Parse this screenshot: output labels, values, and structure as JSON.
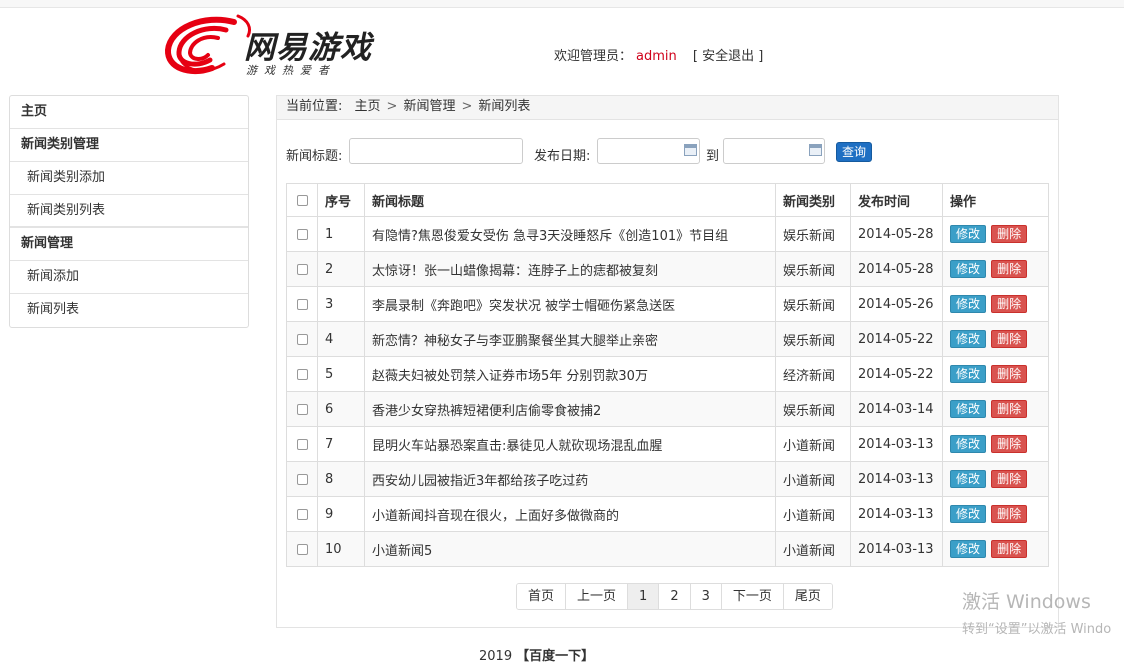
{
  "header": {
    "logo_text": "网易游戏",
    "logo_sub": "游戏热爱者",
    "welcome_label": "欢迎管理员：",
    "username": "admin",
    "logout_label": "[ 安全退出 ]"
  },
  "sidebar": {
    "items": [
      {
        "label": "主页"
      },
      {
        "label": "新闻类别管理"
      },
      {
        "label": "新闻类别添加"
      },
      {
        "label": "新闻类别列表"
      },
      {
        "label": "新闻管理"
      },
      {
        "label": "新闻添加"
      },
      {
        "label": "新闻列表"
      }
    ]
  },
  "breadcrumb": {
    "prefix": "当前位置:",
    "items": [
      "主页",
      "新闻管理",
      "新闻列表"
    ],
    "separator": ">"
  },
  "search": {
    "title_label": "新闻标题:",
    "title_value": "",
    "date_label": "发布日期:",
    "date_from": "",
    "to_label": "到",
    "date_to": "",
    "query_label": "查询"
  },
  "table": {
    "headers": {
      "no": "序号",
      "title": "新闻标题",
      "category": "新闻类别",
      "date": "发布时间",
      "actions": "操作"
    },
    "edit_label": "修改",
    "delete_label": "删除",
    "rows": [
      {
        "no": "1",
        "title": "有隐情?焦恩俊爱女受伤 急寻3天没睡怒斥《创造101》节目组",
        "category": "娱乐新闻",
        "date": "2014-05-28"
      },
      {
        "no": "2",
        "title": "太惊讶！张一山蜡像揭幕：连脖子上的痣都被复刻",
        "category": "娱乐新闻",
        "date": "2014-05-28"
      },
      {
        "no": "3",
        "title": "李晨录制《奔跑吧》突发状况 被学士帽砸伤紧急送医",
        "category": "娱乐新闻",
        "date": "2014-05-26"
      },
      {
        "no": "4",
        "title": "新恋情？神秘女子与李亚鹏聚餐坐其大腿举止亲密",
        "category": "娱乐新闻",
        "date": "2014-05-22"
      },
      {
        "no": "5",
        "title": "赵薇夫妇被处罚禁入证券市场5年 分别罚款30万",
        "category": "经济新闻",
        "date": "2014-05-22"
      },
      {
        "no": "6",
        "title": "香港少女穿热裤短裙便利店偷零食被捕2",
        "category": "娱乐新闻",
        "date": "2014-03-14"
      },
      {
        "no": "7",
        "title": "昆明火车站暴恐案直击:暴徒见人就砍现场混乱血腥",
        "category": "小道新闻",
        "date": "2014-03-13"
      },
      {
        "no": "8",
        "title": "西安幼儿园被指近3年都给孩子吃过药",
        "category": "小道新闻",
        "date": "2014-03-13"
      },
      {
        "no": "9",
        "title": "小道新闻抖音现在很火，上面好多做微商的",
        "category": "小道新闻",
        "date": "2014-03-13"
      },
      {
        "no": "10",
        "title": "小道新闻5",
        "category": "小道新闻",
        "date": "2014-03-13"
      }
    ]
  },
  "pager": {
    "first": "首页",
    "prev": "上一页",
    "pages": [
      "1",
      "2",
      "3"
    ],
    "current": "1",
    "next": "下一页",
    "last": "尾页"
  },
  "footer": {
    "year": "2019",
    "link": "【百度一下】"
  },
  "watermark": {
    "line1": "激活 Windows",
    "line2": "转到“设置”以激活 Windo"
  },
  "colors": {
    "logo_red": "#e60012",
    "admin_red": "#d0021b",
    "query_blue": "#1e6fc3",
    "edit_blue": "#3b9fc8",
    "delete_red": "#d9534f"
  }
}
